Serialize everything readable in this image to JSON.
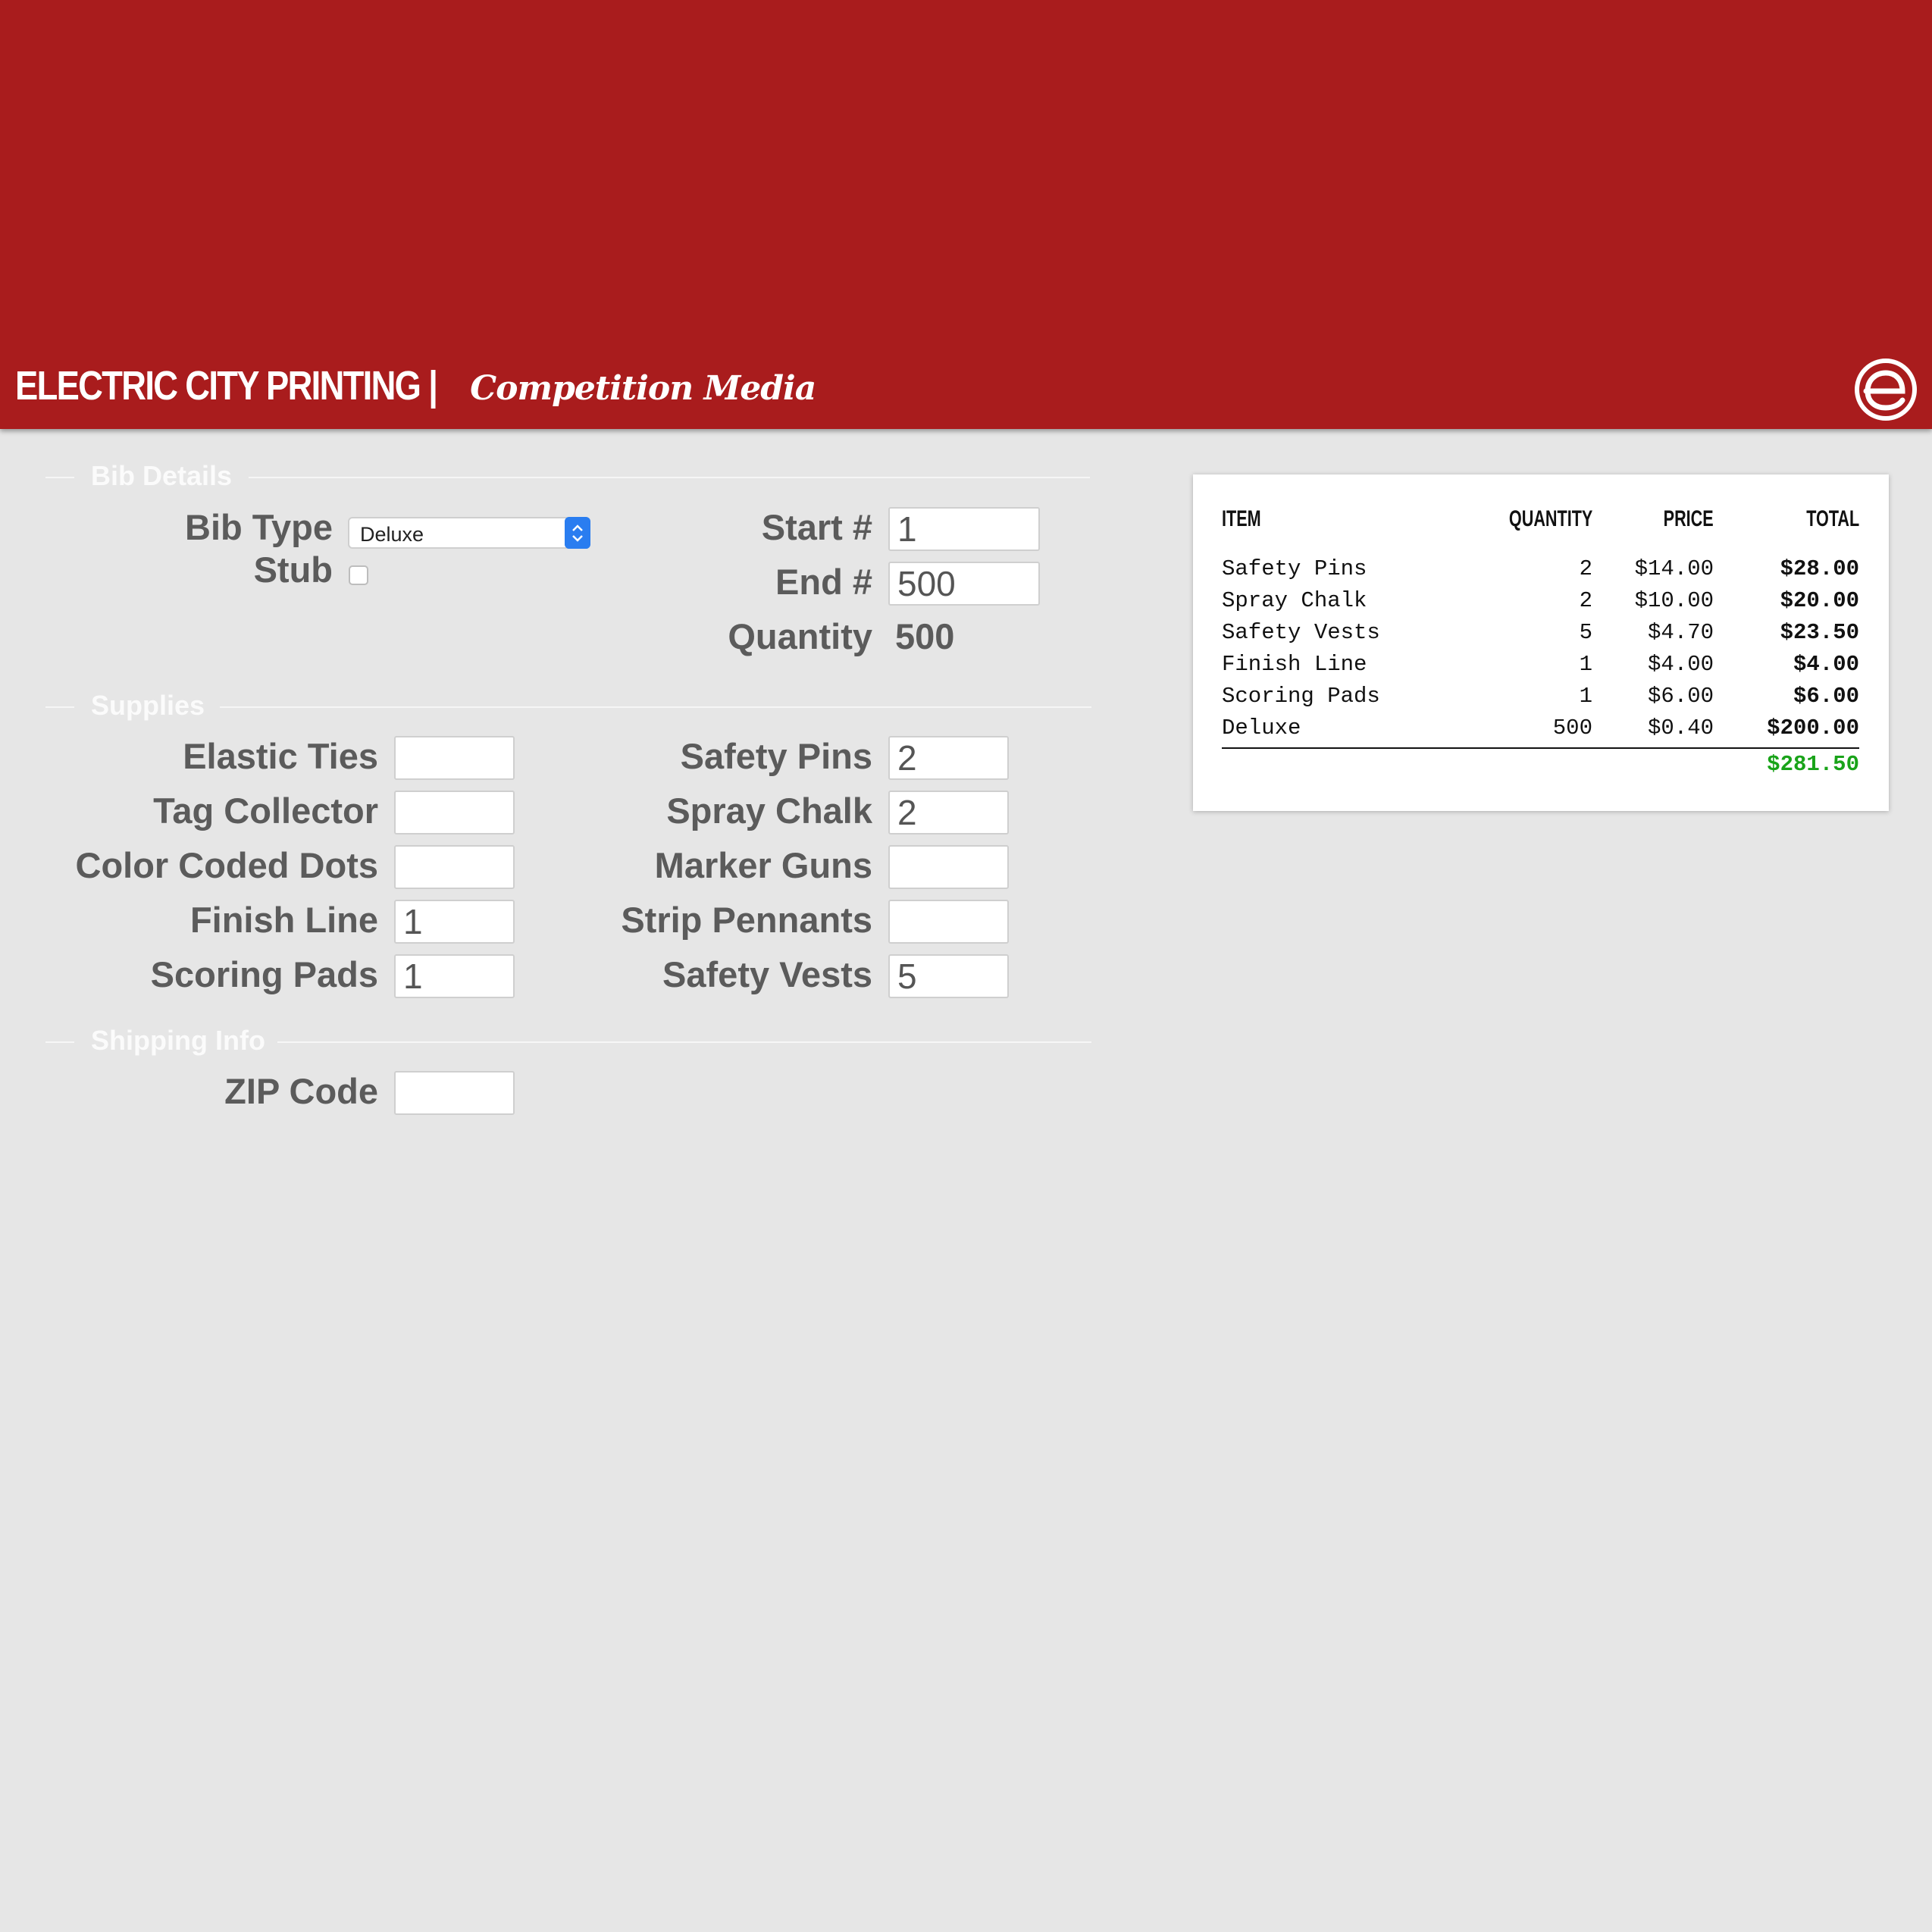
{
  "header": {
    "brand_main": "ELECTRIC CITY PRINTING |",
    "brand_sub": "Competition Media",
    "bg_color": "#a91c1d"
  },
  "sections": {
    "bib": "Bib Details",
    "supplies": "Supplies",
    "shipping": "Shipping Info"
  },
  "bib": {
    "type_label": "Bib Type",
    "type_value": "Deluxe",
    "stub_label": "Stub",
    "stub_checked": false,
    "start_label": "Start #",
    "start_value": "1",
    "end_label": "End #",
    "end_value": "500",
    "quantity_label": "Quantity",
    "quantity_value": "500"
  },
  "supplies": {
    "left": [
      {
        "label": "Elastic Ties",
        "value": ""
      },
      {
        "label": "Tag Collector",
        "value": ""
      },
      {
        "label": "Color Coded Dots",
        "value": ""
      },
      {
        "label": "Finish Line",
        "value": "1"
      },
      {
        "label": "Scoring Pads",
        "value": "1"
      }
    ],
    "right": [
      {
        "label": "Safety Pins",
        "value": "2"
      },
      {
        "label": "Spray Chalk",
        "value": "2"
      },
      {
        "label": "Marker Guns",
        "value": ""
      },
      {
        "label": "Strip Pennants",
        "value": ""
      },
      {
        "label": "Safety Vests",
        "value": "5"
      }
    ]
  },
  "shipping": {
    "zip_label": "ZIP Code",
    "zip_value": ""
  },
  "receipt": {
    "headers": {
      "item": "ITEM",
      "quantity": "QUANTITY",
      "price": "PRICE",
      "total": "TOTAL"
    },
    "rows": [
      {
        "item": "Safety Pins",
        "quantity": "2",
        "price": "$14.00",
        "total": "$28.00"
      },
      {
        "item": "Spray Chalk",
        "quantity": "2",
        "price": "$10.00",
        "total": "$20.00"
      },
      {
        "item": "Safety Vests",
        "quantity": "5",
        "price": "$4.70",
        "total": "$23.50"
      },
      {
        "item": "Finish Line",
        "quantity": "1",
        "price": "$4.00",
        "total": "$4.00"
      },
      {
        "item": "Scoring Pads",
        "quantity": "1",
        "price": "$6.00",
        "total": "$6.00"
      },
      {
        "item": "Deluxe",
        "quantity": "500",
        "price": "$0.40",
        "total": "$200.00"
      }
    ],
    "grand_total": "$281.50",
    "grand_total_color": "#19a319"
  }
}
